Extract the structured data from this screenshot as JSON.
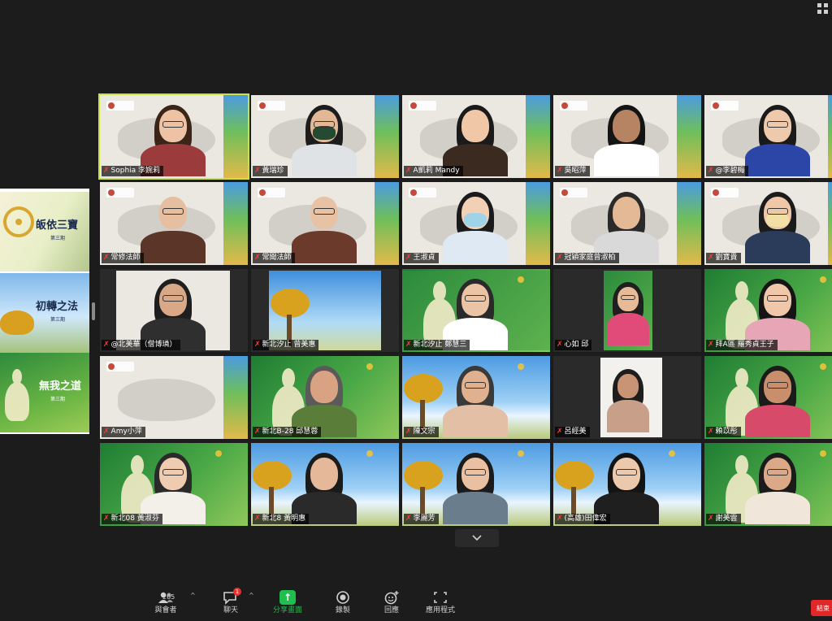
{
  "share": {
    "slides": [
      {
        "title": "皈依三寶",
        "tag": "第三期"
      },
      {
        "title": "初轉之法",
        "tag": "第三期"
      },
      {
        "title": "無我之道",
        "tag": "第三期"
      }
    ]
  },
  "tiles": [
    {
      "name": "Sophia 李婉莉",
      "bg": "map",
      "active": true
    },
    {
      "name": "黃瑞珍",
      "bg": "map"
    },
    {
      "name": "A凱莉 Mandy",
      "bg": "map"
    },
    {
      "name": "吳昭萍",
      "bg": "map"
    },
    {
      "name": "@李碧梅",
      "bg": "map"
    },
    {
      "name": "常修法師",
      "bg": "map"
    },
    {
      "name": "常聞法師",
      "bg": "map"
    },
    {
      "name": "王淑貞",
      "bg": "map"
    },
    {
      "name": "冠穎家庭曾淑柏",
      "bg": "map"
    },
    {
      "name": "劉寶貴",
      "bg": "map"
    },
    {
      "name": "@北美華（僧博璘）",
      "bg": "dark"
    },
    {
      "name": "新北汐止 曾美惠",
      "bg": "dark"
    },
    {
      "name": "新北汐止 鄭慧三",
      "bg": "green"
    },
    {
      "name": "心如 邱",
      "bg": "dark"
    },
    {
      "name": "拜A區 羅秀貞王子",
      "bg": "green"
    },
    {
      "name": "Amy小萍",
      "bg": "map"
    },
    {
      "name": "新北B-28 邱慧蓉",
      "bg": "green"
    },
    {
      "name": "陳文宗",
      "bg": "sky"
    },
    {
      "name": "呂經美",
      "bg": "dark"
    },
    {
      "name": "賴苡彤",
      "bg": "green"
    },
    {
      "name": "新北08 黃淑芬",
      "bg": "green"
    },
    {
      "name": "新北8 黃明惠",
      "bg": "sky"
    },
    {
      "name": "李麗芳",
      "bg": "sky"
    },
    {
      "name": "(高雄)田偉宏",
      "bg": "sky"
    },
    {
      "name": "謝美雲",
      "bg": "green"
    }
  ],
  "toolbar": {
    "participants": {
      "label": "與會者",
      "count": "205"
    },
    "chat": {
      "label": "聊天",
      "badge": "1"
    },
    "share": {
      "label": "分享畫面"
    },
    "record": {
      "label": "錄製"
    },
    "reactions": {
      "label": "回應"
    },
    "view": {
      "label": "應用程式"
    },
    "end": {
      "label": "結束"
    }
  },
  "colors": {
    "accent": "#1fbf4e",
    "end": "#e02828",
    "activeBorder": "#c8e04a",
    "background": "#1c1c1c"
  }
}
